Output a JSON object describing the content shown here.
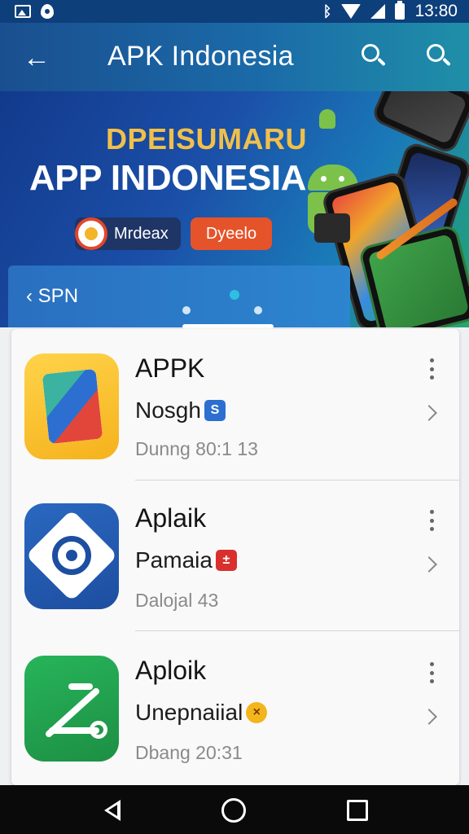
{
  "status_bar": {
    "time": "13:80",
    "icons": [
      "image-icon",
      "flame-icon",
      "bluetooth-icon",
      "wifi-icon",
      "signal-icon",
      "battery-icon"
    ]
  },
  "app_bar": {
    "title": "APK Indonesia",
    "back_icon": "back-arrow-icon",
    "search_icons": [
      "search-icon",
      "search-icon"
    ]
  },
  "banner": {
    "kicker": "DPEISUMARU",
    "headline": "APP INDONESIA",
    "chip_dark_label": "Mrdeax",
    "chip_orange_label": "Dyeelo",
    "strip_label": "SPN",
    "colors": {
      "kicker": "#f0c04a",
      "chip_orange": "#e5532a",
      "chip_dark": "#1e3566"
    }
  },
  "apps": [
    {
      "name": "APPK",
      "description": "Nosgh",
      "badge": "S",
      "badge_color": "#2d6fd0",
      "meta": "Dunng 80:1 13",
      "icon": "gallery-app-icon"
    },
    {
      "name": "Aplaik",
      "description": "Pamaia",
      "badge": "±",
      "badge_color": "#d8302e",
      "meta": "Dalojal 43",
      "icon": "target-app-icon"
    },
    {
      "name": "Aploik",
      "description": "Unepnaiial",
      "badge": "×",
      "badge_color": "#f2b51c",
      "meta": "Dbang 20:31",
      "icon": "tools-app-icon"
    }
  ],
  "nav": {
    "back": "nav-back-icon",
    "home": "nav-home-icon",
    "recent": "nav-recent-icon"
  }
}
